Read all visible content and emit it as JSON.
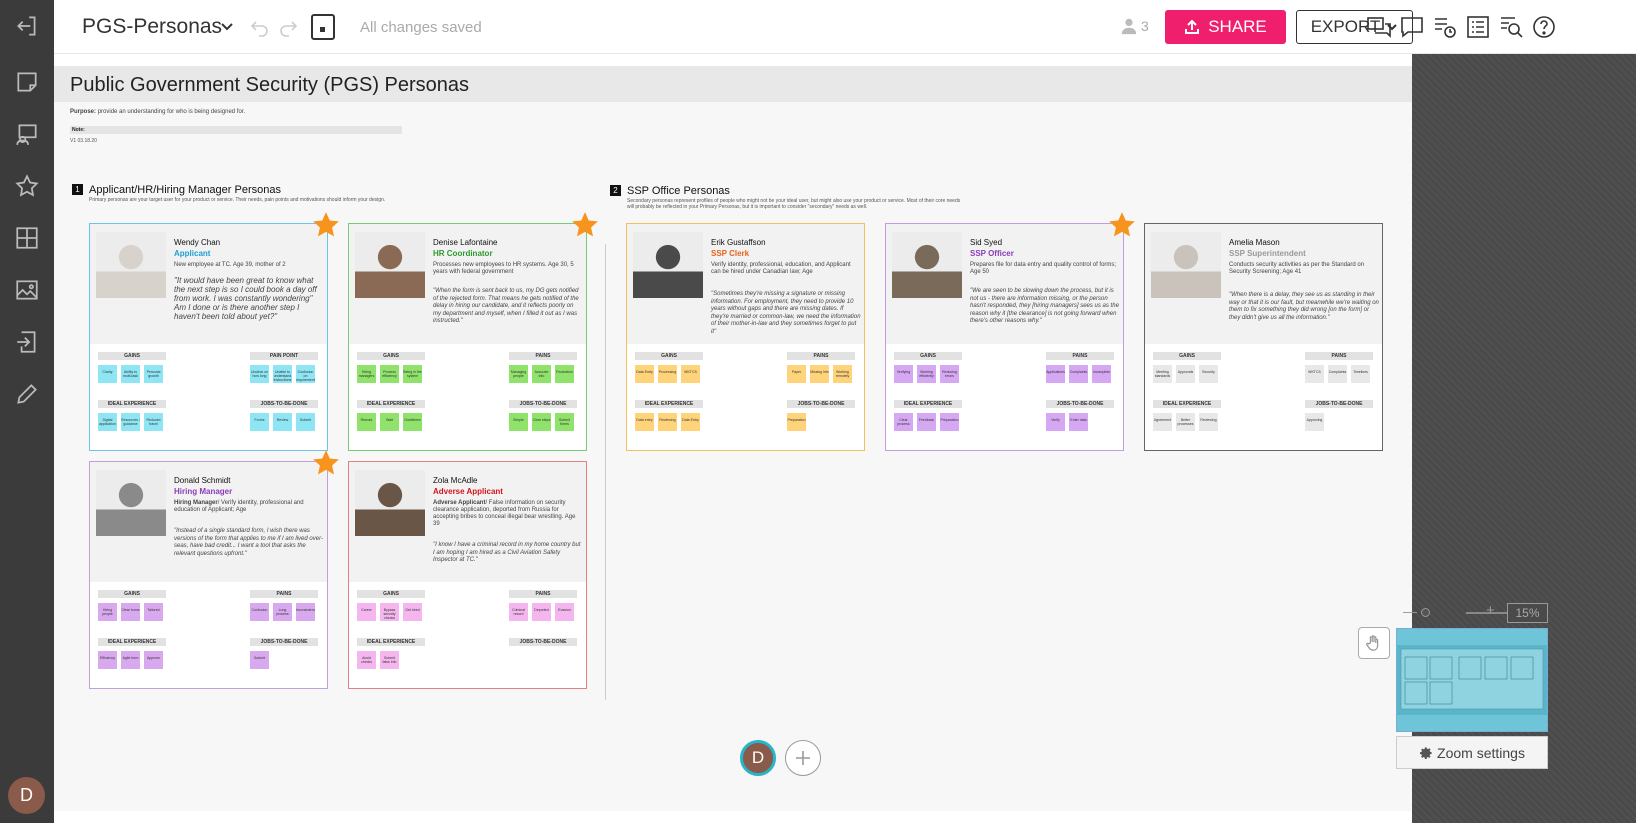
{
  "header": {
    "doc_title": "PGS-Personas",
    "save_status": "All changes saved",
    "collaborator_count": "3",
    "share_label": "SHARE",
    "export_label": "EXPORT"
  },
  "rail": {
    "avatar_initial": "D",
    "icons": [
      "exit-icon",
      "sticky-note-icon",
      "presentation-icon",
      "star-icon",
      "grid-icon",
      "image-icon",
      "import-icon",
      "pencil-icon"
    ]
  },
  "board": {
    "title": "Public Government Security (PGS) Personas",
    "purpose_label": "Purpose:",
    "purpose_text": "provide an understanding for who is being designed for.",
    "note_label": "Note:",
    "version": "V1 03.18.20"
  },
  "sections": [
    {
      "num": "1",
      "title": "Applicant/HR/Hiring Manager Personas",
      "desc": "Primary personas are your target user for your product or service. Their needs, pain points and motivations should inform your design."
    },
    {
      "num": "2",
      "title": "SSP Office Personas",
      "desc": "Secondary personas represent profiles of people who might not be your ideal user, but might also use your product or service. Most of their core needs will probably be reflected in your Primary Personas, but it is important to consider \"secondary\" needs as well."
    }
  ],
  "personas": [
    {
      "name": "Wendy Chan",
      "role": "Applicant",
      "desc": "New employee at TC.  Age 39, mother of 2",
      "quote": "\"It would have been great to know what the next step is so I could book a day off from work. I was constantly wondering\" Am I done or is there another step I haven't been told about yet?\"",
      "labels": [
        "GAINS",
        "PAIN POINT",
        "IDEAL EXPERIENCE",
        "JOBS-TO-BE-DONE"
      ]
    },
    {
      "name": "Denise Lafontaine",
      "role": "HR Coordinator",
      "desc": "Processes new employees to HR systems. Age 30, 5 years with federal government",
      "quote": "\"When the form is sent back to us, my DG gets notified of the rejected form. That means he gets notified of the delay in hiring our candidate, and it reflects poorly on my department and myself, when I filled it out as I was instructed.\"",
      "labels": [
        "GAINS",
        "PAINS",
        "IDEAL EXPERIENCE",
        "JOBS-TO-BE-DONE"
      ]
    },
    {
      "name": "Erik Gustaffson",
      "role": "SSP Clerk",
      "desc": "Verify identity, professional, education, and Applicant can be hired under Canadian law; Age",
      "quote": "\"Sometimes they're missing a signature or missing information. For employment, they need to provide 10 years without gaps and there are missing dates. If they're married or common-law, we need the information of their mother-in-law and they sometimes forget to put it\"",
      "labels": [
        "GAINS",
        "PAINS",
        "IDEAL EXPERIENCE",
        "JOBS-TO-BE-DONE"
      ]
    },
    {
      "name": "Sid Syed",
      "role": "SSP Officer",
      "desc": "Prepares file for data entry and quality control of forms; Age 50",
      "quote": "\"We are seen to be slowing down the process, but it is not us - there are information missing, or the person hasn't responded, they [hiring managers] sees us as the reason why it [the clearance] is not going forward when there's other reasons why.\"",
      "labels": [
        "GAINS",
        "PAINS",
        "IDEAL EXPERIENCE",
        "JOBS-TO-BE-DONE"
      ]
    },
    {
      "name": "Amelia Mason",
      "role": "SSP Superintendent",
      "desc": "Conducts security activities as per the Standard on Security Screening; Age 41",
      "quote": "\"When there is a delay, they see us as standing in their way or that it is our fault, but meanwhile we're waiting on them to fix something they did wrong [on the form] or they didn't give us all the information.\"",
      "labels": [
        "GAINS",
        "PAINS",
        "IDEAL EXPERIENCE",
        "JOBS-TO-BE-DONE"
      ]
    },
    {
      "name": "Donald Schmidt",
      "role": "Hiring Manager",
      "desc_bold": "Hiring Manager",
      "desc": "/ Verify identity, professional and education of Applicant; Age",
      "quote": "\"Instead of a single standard form, I wish there was versions of the form that applies to me if I am lived over-seas, have bad credit... I want a tool that asks the relevant questions upfront.\"",
      "labels": [
        "GAINS",
        "PAINS",
        "IDEAL EXPERIENCE",
        "JOBS-TO-BE-DONE"
      ]
    },
    {
      "name": "Zola McAdle",
      "role": "Adverse Applicant",
      "desc_bold": "Adverse Applicant",
      "desc": "/ False information on security clearance application, deported from Russia for accepting bribes to conceal illegal bear wrestling. Age 39",
      "quote": "\"I know I have a criminal record in my home country but I am hoping I am hired as a Civil Aviation Safety Inspector at TC.\"",
      "labels": [
        "GAINS",
        "PAINS",
        "IDEAL EXPERIENCE",
        "JOBS-TO-BE-DONE"
      ]
    }
  ],
  "stickies": {
    "wendy": [
      "Clarity",
      "Ability to multi-task",
      "Personal growth",
      "Unclear on how long",
      "Unable to understand instructions",
      "Confusion on requirements",
      "Digital application",
      "Resources / guidance",
      "Reduced travel",
      "Forms",
      "Review",
      "Submit",
      "Track"
    ],
    "denise": [
      "Hiring managers",
      "Process efficiency",
      "Being in the system",
      "Managing people",
      "Accurate info",
      "Frustration",
      "Rework",
      "Wait",
      "Guidelines",
      "Simple",
      "Clear steps",
      "Submit forms",
      "Verify",
      "Notify",
      "Track"
    ],
    "erik": [
      "Data Entry",
      "Processing",
      "WKTCS",
      "Paper",
      "Missing info",
      "Working remotely",
      "Data entry",
      "Reviewing",
      "Data Entry",
      "Preparation"
    ],
    "sid": [
      "Verifying",
      "Working efficiently",
      "Reducing errors",
      "Applications",
      "Complaints",
      "Incomplete",
      "Clear process",
      "Feedback",
      "Preparation",
      "Verify",
      "Enter data"
    ],
    "amelia": [
      "Meeting standards",
      "Approvals",
      "Security",
      "WKTCS",
      "Complaints",
      "Timelines",
      "Agreement",
      "Better processes",
      "Reviewing",
      "Approving"
    ],
    "donald": [
      "Hiring people",
      "Clear forms",
      "Tailored",
      "Confusion",
      "Long process",
      "Inconsistency",
      "Efficiency",
      "Agile form",
      "Approve",
      "Submit"
    ],
    "zola": [
      "Career",
      "Bypass security checks",
      "Get hired",
      "Criminal record",
      "Deported",
      "Evasion",
      "Avoid checks",
      "Submit false info"
    ]
  },
  "colors": {
    "share": "#ef1f6d",
    "wendy_border": "#6cc5e6",
    "wendy_role": "#1fa0d0",
    "wendy_sticky": "#8ee6f5",
    "denise_border": "#78c97a",
    "denise_role": "#2e9a2e",
    "denise_sticky": "#8fe26a",
    "erik_border": "#f2c060",
    "erik_role": "#e8631a",
    "erik_sticky": "#ffd37a",
    "sid_border": "#c59ae0",
    "sid_role": "#8a3db8",
    "sid_sticky": "#d6a7f2",
    "amelia_border": "#666666",
    "amelia_role": "#999999",
    "amelia_sticky": "#e8e8e8",
    "donald_border": "#c0a0d8",
    "donald_role": "#8a3db8",
    "donald_sticky": "#d9a9ef",
    "zola_border": "#e58080",
    "zola_role": "#d4141e",
    "zola_sticky": "#f5b5ee",
    "star": "#f7941d"
  },
  "zoom": {
    "level": "15%",
    "settings_label": "Zoom settings"
  },
  "footer": {
    "user_initial": "D"
  }
}
